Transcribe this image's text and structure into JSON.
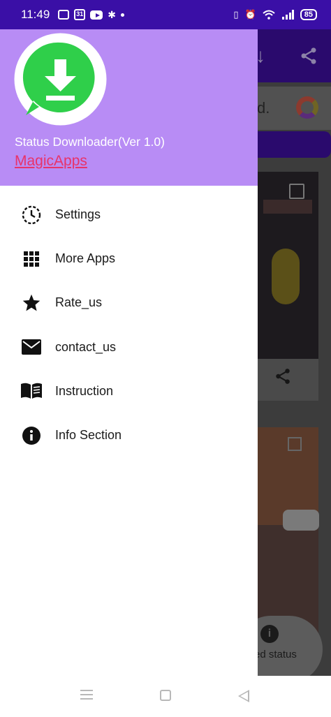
{
  "status_bar": {
    "time": "11:49",
    "calendar_day": "31",
    "battery": "85"
  },
  "drawer": {
    "app_title": "Status Downloader(Ver 1.0)",
    "developer_link": "MagicApps",
    "items": [
      {
        "label": "Settings",
        "icon": "clock-settings-icon"
      },
      {
        "label": "More Apps",
        "icon": "grid-apps-icon"
      },
      {
        "label": "Rate_us",
        "icon": "star-icon"
      },
      {
        "label": "contact_us",
        "icon": "mail-icon"
      },
      {
        "label": "Instruction",
        "icon": "book-icon"
      },
      {
        "label": "Info Section",
        "icon": "info-icon"
      }
    ]
  },
  "background": {
    "ad_text_fragment": "d.",
    "fab_label_fragment": "ed status"
  },
  "colors": {
    "status_bar": "#3a0fa6",
    "drawer_header": "#b88cf5",
    "logo_green": "#2fcf4a",
    "link": "#e8336a"
  }
}
